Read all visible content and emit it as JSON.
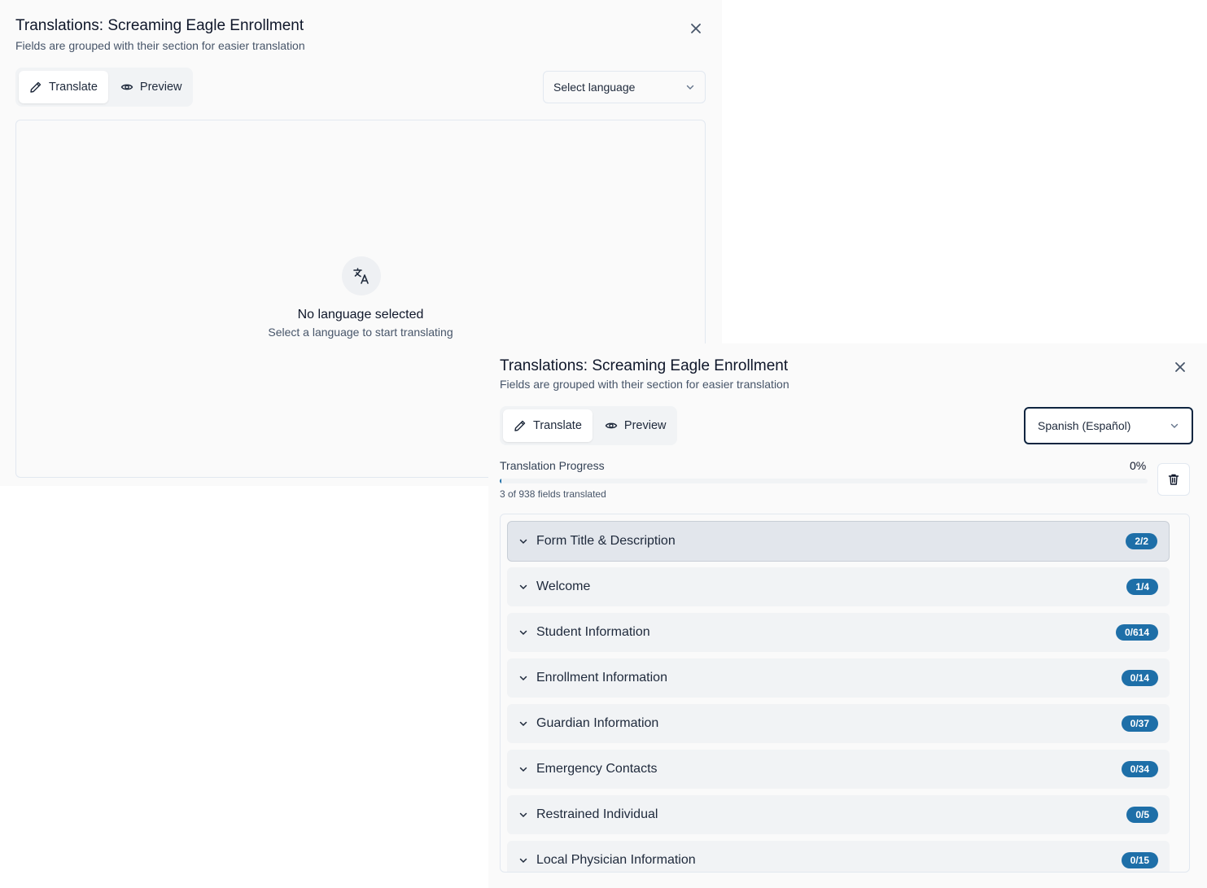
{
  "panel_a": {
    "title": "Translations: Screaming Eagle Enrollment",
    "subtitle": "Fields are grouped with their section for easier translation",
    "tabs": [
      {
        "label": "Translate",
        "icon": "pencil-icon",
        "active": true
      },
      {
        "label": "Preview",
        "icon": "eye-icon",
        "active": false
      }
    ],
    "language_select": {
      "value": "Select language",
      "icon": "chevron-down-icon"
    },
    "empty_state": {
      "icon": "translate-icon",
      "title": "No language selected",
      "message": "Select a language to start translating"
    },
    "close_icon": "close-icon"
  },
  "panel_b": {
    "title": "Translations: Screaming Eagle Enrollment",
    "subtitle": "Fields are grouped with their section for easier translation",
    "tabs": [
      {
        "label": "Translate",
        "icon": "pencil-icon",
        "active": true
      },
      {
        "label": "Preview",
        "icon": "eye-icon",
        "active": false
      }
    ],
    "language_select": {
      "value": "Spanish (Español)",
      "icon": "chevron-down-icon"
    },
    "progress": {
      "label": "Translation Progress",
      "percent_text": "0%",
      "percent": 0.3,
      "count_text": "3 of 938 fields translated"
    },
    "trash_icon": "trash-icon",
    "close_icon": "close-icon",
    "sections": [
      {
        "label": "Form Title & Description",
        "badge": "2/2"
      },
      {
        "label": "Welcome",
        "badge": "1/4"
      },
      {
        "label": "Student Information",
        "badge": "0/614"
      },
      {
        "label": "Enrollment Information",
        "badge": "0/14"
      },
      {
        "label": "Guardian Information",
        "badge": "0/37"
      },
      {
        "label": "Emergency Contacts",
        "badge": "0/34"
      },
      {
        "label": "Restrained Individual",
        "badge": "0/5"
      },
      {
        "label": "Local Physician Information",
        "badge": "0/15"
      }
    ]
  },
  "colors": {
    "accent": "#1e6fa8",
    "panel_bg": "#fafafa",
    "tab_track": "#f1f3f5",
    "focus_ring": "#0f2540"
  }
}
